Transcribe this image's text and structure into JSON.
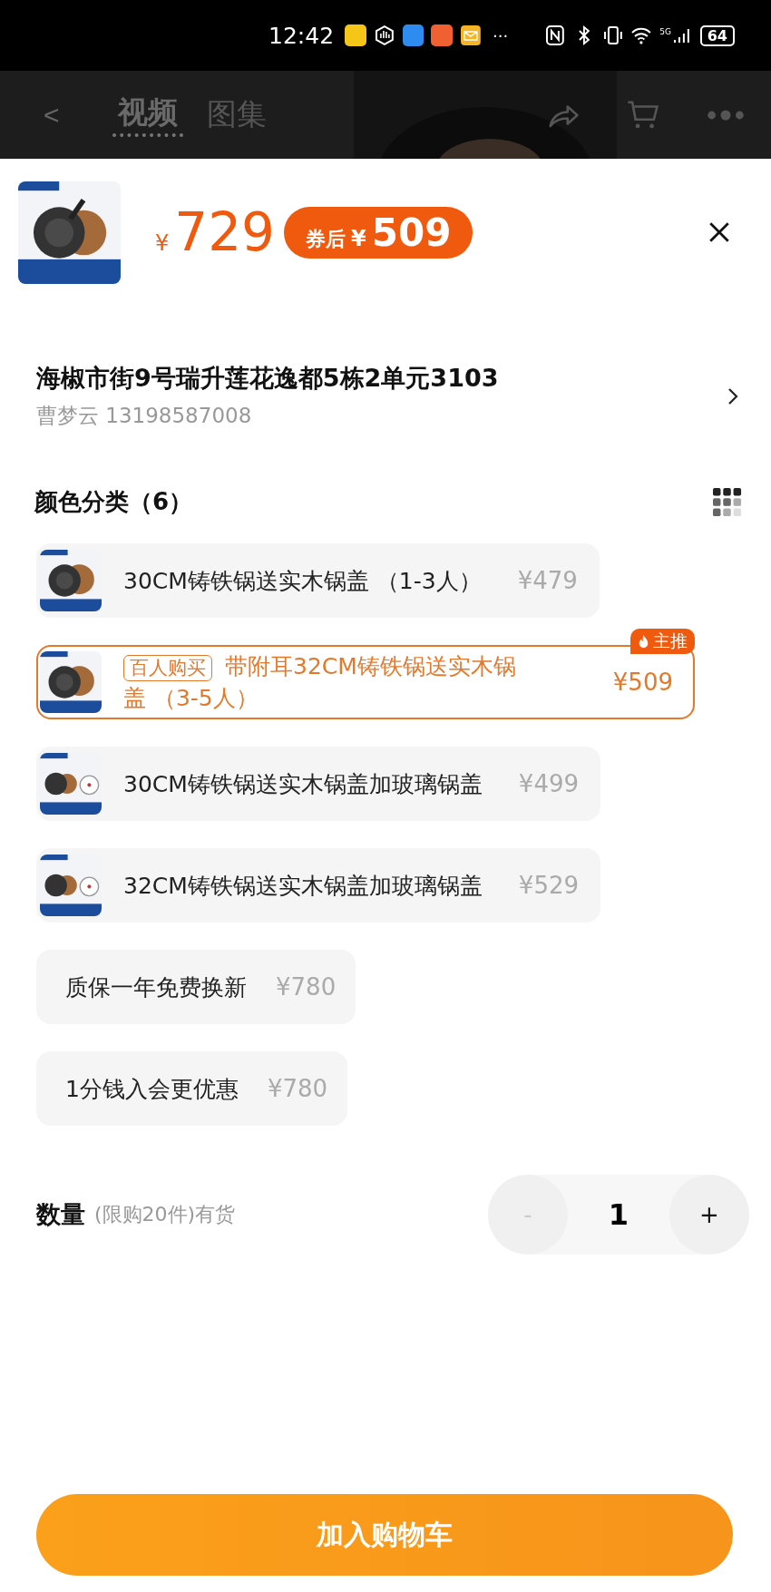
{
  "status_bar": {
    "time": "12:42",
    "more": "···",
    "network": "5G",
    "battery": "64"
  },
  "nav": {
    "back": "<",
    "tabs": [
      {
        "label": "视频",
        "selected": true
      },
      {
        "label": "图集",
        "selected": false
      }
    ]
  },
  "price": {
    "currency": "¥",
    "amount": "729",
    "coupon_label": "券后",
    "coupon_currency": "¥",
    "coupon_amount": "509"
  },
  "address": {
    "line": "海椒市街9号瑞升莲花逸都5栋2单元3103",
    "contact": "曹梦云 13198587008"
  },
  "options_title": "颜色分类（6）",
  "options": [
    {
      "kind": "thumb",
      "label": "30CM铸铁锅送实木锅盖 （1-3人）",
      "price": "¥479",
      "selected": false,
      "lid": false
    },
    {
      "kind": "thumb",
      "label": "带附耳32CM铸铁锅送实木锅盖 （3-5人）",
      "price": "¥509",
      "selected": true,
      "lid": false,
      "tag": "百人购买",
      "badge": "主推"
    },
    {
      "kind": "thumb",
      "label": "30CM铸铁锅送实木锅盖加玻璃锅盖",
      "price": "¥499",
      "selected": false,
      "lid": true
    },
    {
      "kind": "thumb",
      "label": "32CM铸铁锅送实木锅盖加玻璃锅盖",
      "price": "¥529",
      "selected": false,
      "lid": true
    },
    {
      "kind": "text",
      "label": "质保一年免费换新",
      "price": "¥780",
      "selected": false
    },
    {
      "kind": "text",
      "label": "1分钱入会更优惠",
      "price": "¥780",
      "selected": false
    }
  ],
  "quantity": {
    "label": "数量",
    "note": "(限购20件)有货",
    "minus": "-",
    "value": "1",
    "plus": "+",
    "minus_disabled": true
  },
  "add_to_cart": "加入购物车"
}
